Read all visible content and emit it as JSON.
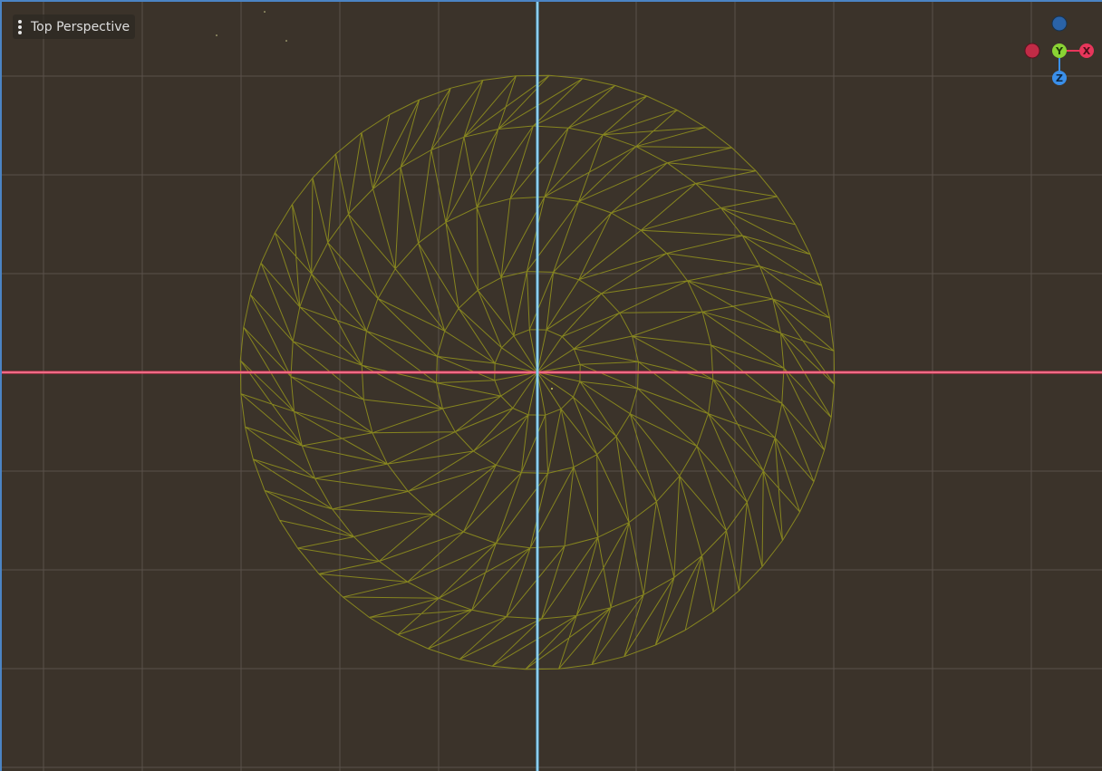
{
  "viewport": {
    "view_label": "Top Perspective"
  },
  "gizmo": {
    "y_label": "Y",
    "x_label": "X",
    "z_label": "Z",
    "x_color": "#e8365b",
    "y_color": "#8ad234",
    "z_color": "#3a8fea",
    "neg_x_color": "#c22b46",
    "neg_z_color": "#2a63a8"
  },
  "colors": {
    "background": "#3b332a",
    "grid": "#59504a",
    "mesh_wire": "#86851f",
    "x_axis": "#e8365b",
    "z_axis": "#5fb8e6",
    "viewport_border": "#4b84c4"
  }
}
